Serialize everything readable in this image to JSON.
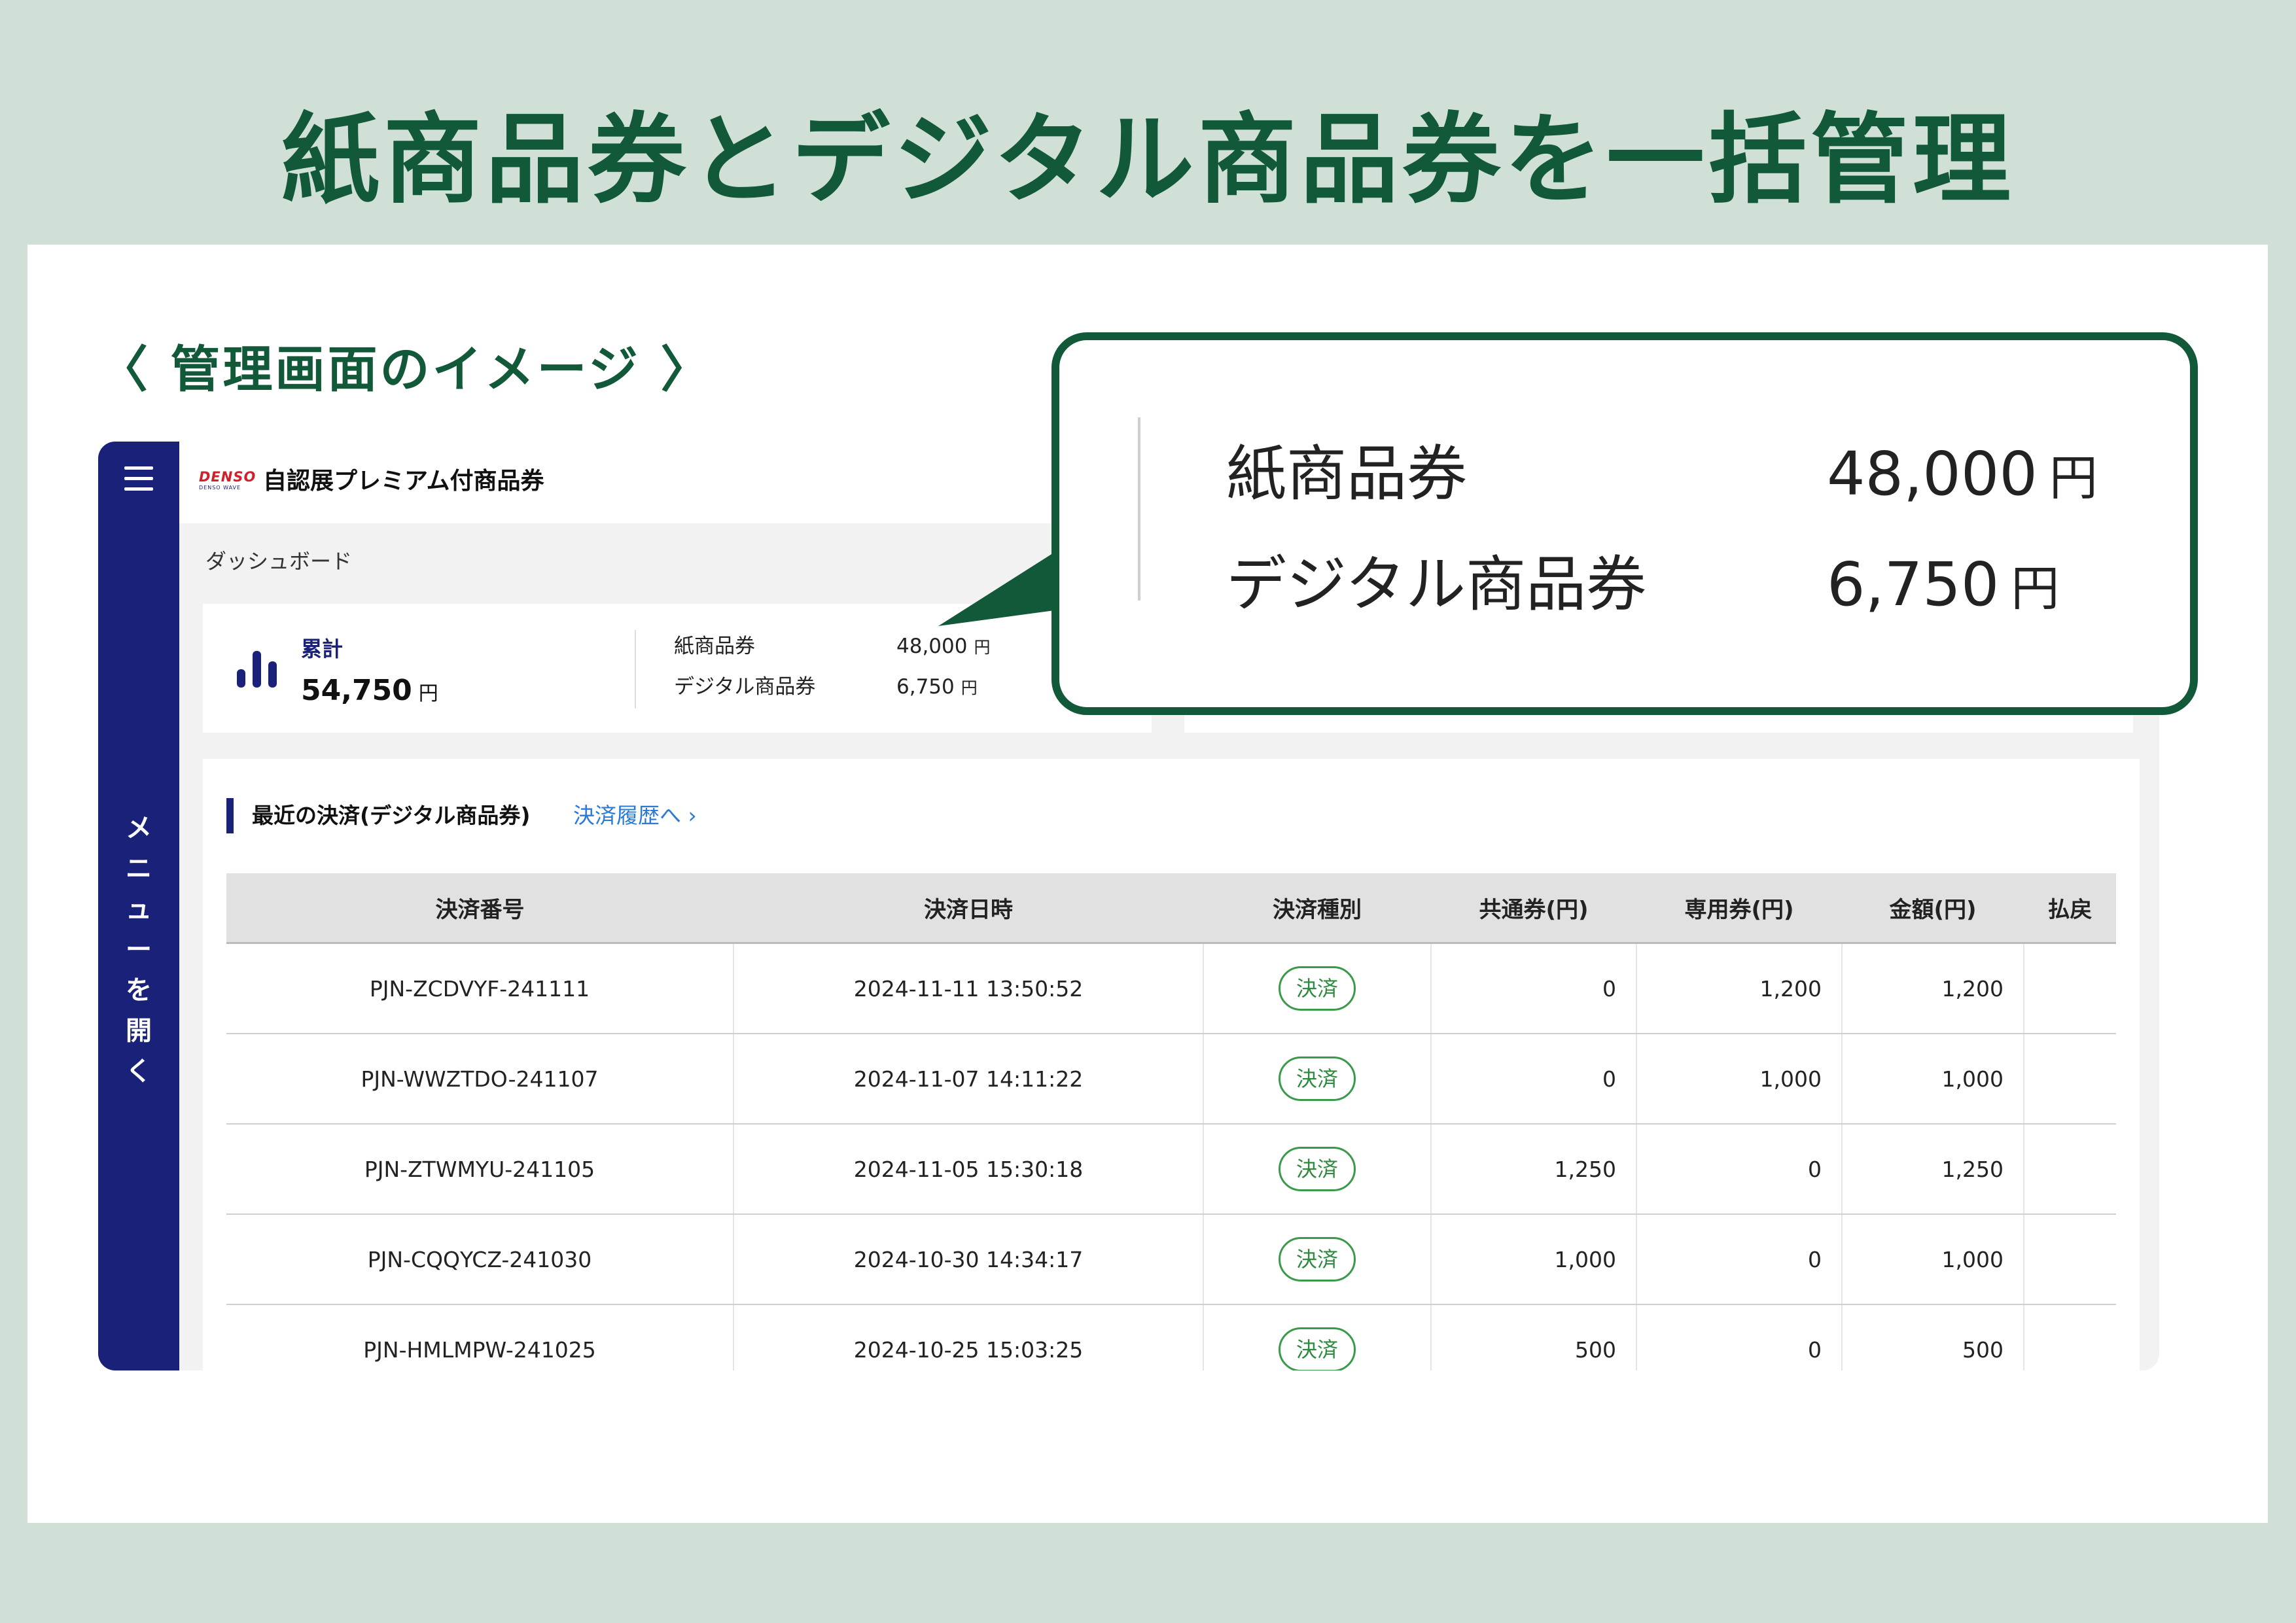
{
  "headline": "紙商品券とデジタル商品券を一括管理",
  "section_label": "〈 管理画面のイメージ 〉",
  "app": {
    "rail_menu_label": "メニューを開く",
    "logo_main": "DENSO",
    "logo_sub": "DENSO WAVE",
    "title": "自認展プレミアム付商品券",
    "breadcrumb": "ダッシュボード"
  },
  "summary": {
    "total_label": "累計",
    "total_value": "54,750",
    "total_unit": "円",
    "paper_label": "紙商品券",
    "paper_value": "48,000",
    "digital_label": "デジタル商品券",
    "digital_value": "6,750",
    "unit": "円"
  },
  "recent": {
    "title": "最近の決済(デジタル商品券)",
    "history_link": "決済履歴へ ›",
    "columns": [
      "決済番号",
      "決済日時",
      "決済種別",
      "共通券(円)",
      "専用券(円)",
      "金額(円)",
      "払戻"
    ],
    "rows": [
      {
        "id": "PJN-ZCDVYF-241111",
        "datetime": "2024-11-11 13:50:52",
        "type": "決済",
        "common": "0",
        "dedicated": "1,200",
        "amount": "1,200",
        "refund": ""
      },
      {
        "id": "PJN-WWZTDO-241107",
        "datetime": "2024-11-07 14:11:22",
        "type": "決済",
        "common": "0",
        "dedicated": "1,000",
        "amount": "1,000",
        "refund": ""
      },
      {
        "id": "PJN-ZTWMYU-241105",
        "datetime": "2024-11-05 15:30:18",
        "type": "決済",
        "common": "1,250",
        "dedicated": "0",
        "amount": "1,250",
        "refund": ""
      },
      {
        "id": "PJN-CQQYCZ-241030",
        "datetime": "2024-10-30 14:34:17",
        "type": "決済",
        "common": "1,000",
        "dedicated": "0",
        "amount": "1,000",
        "refund": ""
      },
      {
        "id": "PJN-HMLMPW-241025",
        "datetime": "2024-10-25 15:03:25",
        "type": "決済",
        "common": "500",
        "dedicated": "0",
        "amount": "500",
        "refund": ""
      }
    ]
  },
  "callout": {
    "paper_label": "紙商品券",
    "paper_value": "48,000",
    "digital_label": "デジタル商品券",
    "digital_value": "6,750",
    "unit": "円"
  },
  "colors": {
    "brand_green": "#12593a",
    "background": "#d1e0d6",
    "navy": "#1a2178",
    "link_blue": "#2b7bd6",
    "pill_green": "#3a9a4a"
  },
  "icons": {
    "menu": "hamburger-icon",
    "total": "bar-chart-icon",
    "link": "chevron-right-icon"
  }
}
